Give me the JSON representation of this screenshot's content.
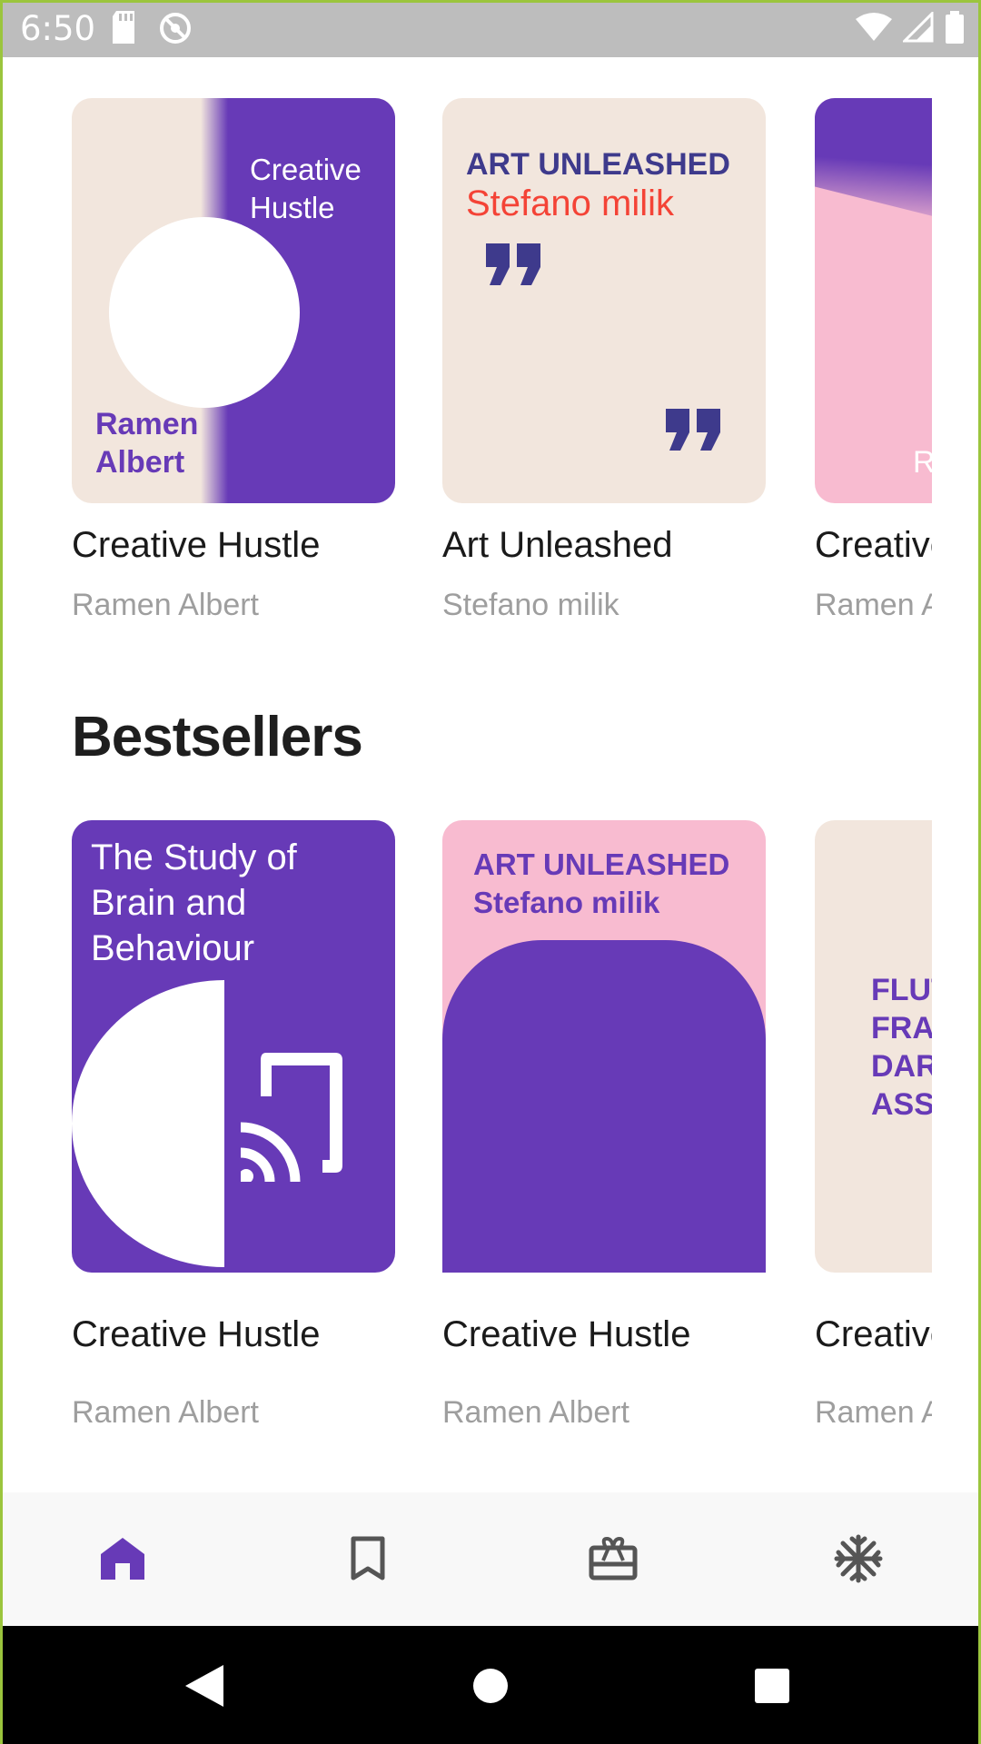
{
  "status_bar": {
    "time": "6:50",
    "icons": [
      "sd-card-icon",
      "sync-disabled-icon",
      "wifi-icon",
      "signal-icon",
      "battery-icon"
    ]
  },
  "featured": {
    "books": [
      {
        "cover": {
          "style": "split-beige-purple-circle",
          "top_text_1": "Creative",
          "top_text_2": "Hustle",
          "author_1": "Ramen",
          "author_2": "Albert"
        },
        "title": "Creative Hustle",
        "author": "Ramen Albert"
      },
      {
        "cover": {
          "style": "beige-quotes",
          "heading": "ART UNLEASHED",
          "subheading": "Stefano milik"
        },
        "title": "Art Unleashed",
        "author": "Stefano milik"
      },
      {
        "cover": {
          "style": "purple-pink-diagonal",
          "corner_text": "R"
        },
        "title": "Creative Hustle",
        "author": "Ramen Albert"
      }
    ]
  },
  "bestsellers": {
    "heading": "Bestsellers",
    "books": [
      {
        "cover": {
          "style": "purple-half-circle-cast",
          "line_1": "The Study of",
          "line_2": "Brain and",
          "line_3": "Behaviour"
        },
        "title": "Creative Hustle",
        "author": "Ramen Albert"
      },
      {
        "cover": {
          "style": "pink-purple-arch",
          "heading": "ART UNLEASHED",
          "subheading": "Stefano milik"
        },
        "title": "Creative Hustle",
        "author": "Ramen Albert"
      },
      {
        "cover": {
          "style": "beige-text",
          "line_1": "FLUT",
          "line_2": "FRA",
          "line_3": "DAR",
          "line_4": "ASS"
        },
        "title": "Creative Hustle",
        "author": "Ramen Albert"
      }
    ]
  },
  "bottom_nav": {
    "items": [
      "home-icon",
      "bookmark-icon",
      "gift-card-icon",
      "snowflake-icon"
    ],
    "active": "home-icon"
  },
  "colors": {
    "purple": "#673ab7",
    "beige": "#f2e6dd",
    "pink": "#f8bbd0",
    "navy": "#3e3a8c",
    "red": "#f44336"
  }
}
